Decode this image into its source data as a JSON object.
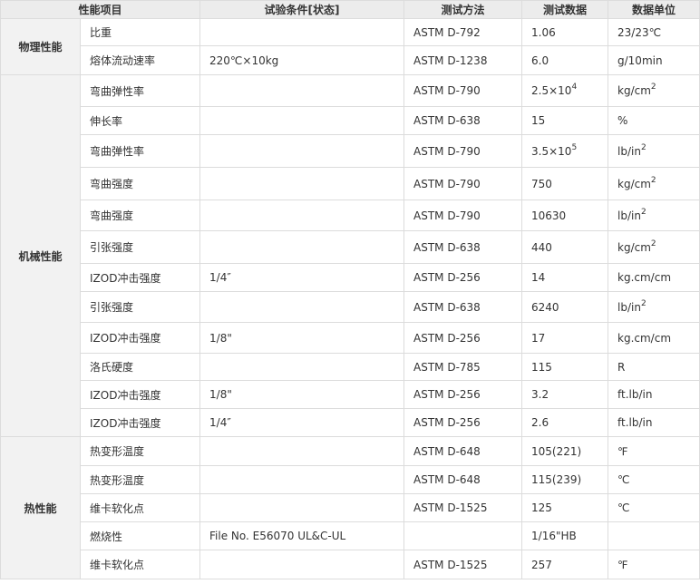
{
  "header": [
    "性能项目",
    "试验条件[状态]",
    "测试方法",
    "测试数据",
    "数据单位"
  ],
  "groups": [
    {
      "name": "物理性能",
      "rows": [
        {
          "item": "比重",
          "cond": "",
          "method": "ASTM D-792",
          "value": "1.06",
          "unit": "23/23℃"
        },
        {
          "item": "熔体流动速率",
          "cond": "220℃×10kg",
          "method": "ASTM D-1238",
          "value": "6.0",
          "unit": "g/10min"
        }
      ]
    },
    {
      "name": "机械性能",
      "rows": [
        {
          "item": "弯曲弹性率",
          "cond": "",
          "method": "ASTM D-790",
          "value": "2.5×10",
          "value_sup": "4",
          "unit": "kg/cm",
          "unit_sup": "2"
        },
        {
          "item": "伸长率",
          "cond": "",
          "method": "ASTM D-638",
          "value": "15",
          "unit": "%"
        },
        {
          "item": "弯曲弹性率",
          "cond": "",
          "method": "ASTM D-790",
          "value": "3.5×10",
          "value_sup": "5",
          "unit": "lb/in",
          "unit_sup": "2"
        },
        {
          "item": "弯曲强度",
          "cond": "",
          "method": "ASTM D-790",
          "value": "750",
          "unit": "kg/cm",
          "unit_sup": "2"
        },
        {
          "item": "弯曲强度",
          "cond": "",
          "method": "ASTM D-790",
          "value": "10630",
          "unit": "lb/in",
          "unit_sup": "2"
        },
        {
          "item": "引张强度",
          "cond": "",
          "method": "ASTM D-638",
          "value": "440",
          "unit": "kg/cm",
          "unit_sup": "2"
        },
        {
          "item": "IZOD冲击强度",
          "cond": "1/4″",
          "method": "ASTM D-256",
          "value": "14",
          "unit": "kg.cm/cm"
        },
        {
          "item": "引张强度",
          "cond": "",
          "method": "ASTM D-638",
          "value": "6240",
          "unit": "lb/in",
          "unit_sup": "2"
        },
        {
          "item": "IZOD冲击强度",
          "cond": "1/8\"",
          "method": "ASTM D-256",
          "value": "17",
          "unit": "kg.cm/cm"
        },
        {
          "item": "洛氏硬度",
          "cond": "",
          "method": "ASTM D-785",
          "value": "115",
          "unit": "R"
        },
        {
          "item": "IZOD冲击强度",
          "cond": "1/8\"",
          "method": "ASTM D-256",
          "value": "3.2",
          "unit": "ft.lb/in"
        },
        {
          "item": "IZOD冲击强度",
          "cond": "1/4″",
          "method": "ASTM D-256",
          "value": "2.6",
          "unit": "ft.lb/in"
        }
      ]
    },
    {
      "name": "热性能",
      "rows": [
        {
          "item": "热变形温度",
          "cond": "",
          "method": "ASTM D-648",
          "value": "105(221)",
          "unit": "℉"
        },
        {
          "item": "热变形温度",
          "cond": "",
          "method": "ASTM D-648",
          "value": "115(239)",
          "unit": "℃"
        },
        {
          "item": "维卡软化点",
          "cond": "",
          "method": "ASTM D-1525",
          "value": "125",
          "unit": "℃"
        },
        {
          "item": "燃烧性",
          "cond": "File No. E56070 UL&C-UL",
          "method": "",
          "value": "1/16\"HB",
          "unit": ""
        },
        {
          "item": "维卡软化点",
          "cond": "",
          "method": "ASTM D-1525",
          "value": "257",
          "unit": "℉"
        }
      ]
    }
  ]
}
